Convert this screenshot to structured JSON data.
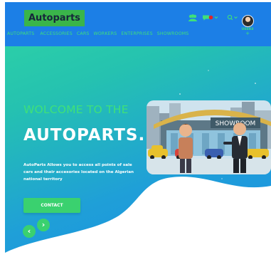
{
  "brand": {
    "logo_text": "Autoparts"
  },
  "nav": {
    "links": [
      "AUTOPARTS",
      "ACCESSORIES",
      "CARS",
      "WORKERS",
      "ENTERPRISES",
      "SHOWROOMS"
    ]
  },
  "icons": {
    "users": "users-icon",
    "notifications": "notification-icon",
    "search": "search-icon"
  },
  "user": {
    "name": "USER3",
    "plus": "+"
  },
  "hero": {
    "welcome": "WOLCOME TO THE",
    "title": "AUTOPARTS.",
    "description": "AutoParts Allows you to access all points of sale cars and their accesories located on the Algerian national territory",
    "contact_label": "CONTACT",
    "prev_label": "‹",
    "next_label": "›"
  },
  "illustration": {
    "sign_text": "SHOWROOM"
  },
  "colors": {
    "navbar": "#1c7fe6",
    "accent_green": "#3ad16f",
    "link_green": "#3fe07a",
    "logo_bg": "#3ab54a",
    "badge_red": "#e02525"
  }
}
